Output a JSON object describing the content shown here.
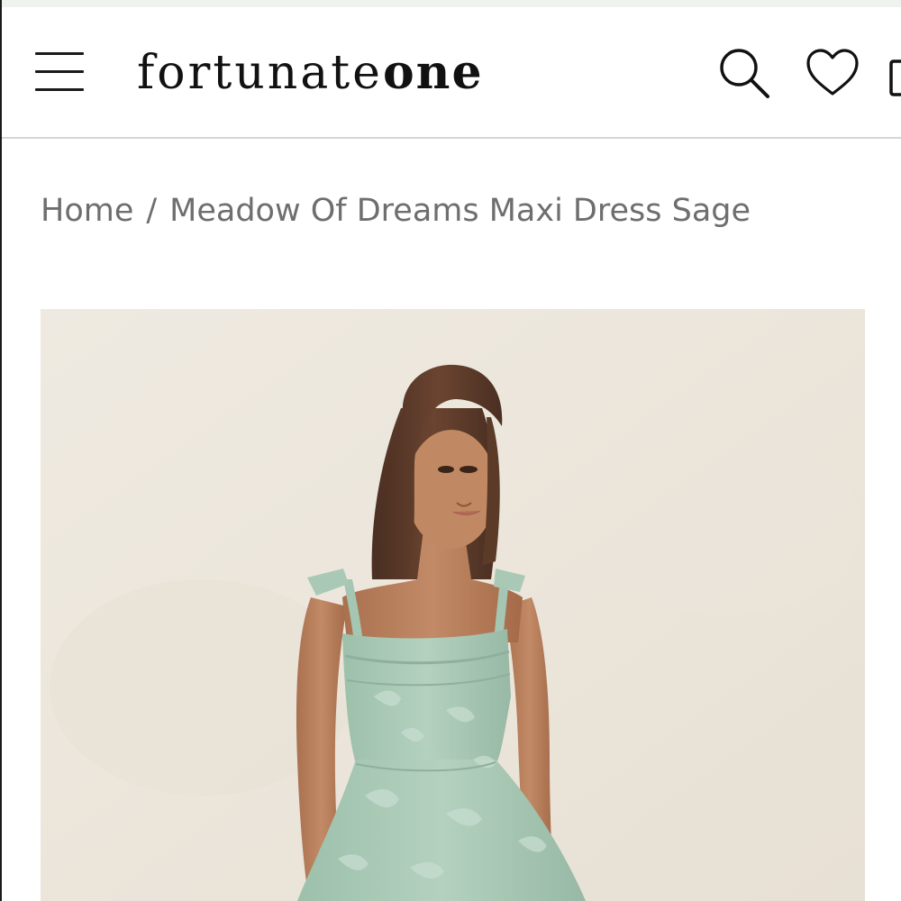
{
  "brand": {
    "logo_light": "fortunate",
    "logo_bold": "one"
  },
  "header": {
    "menu_icon": "hamburger-menu-icon",
    "search_icon": "search-icon",
    "wishlist_icon": "heart-icon",
    "cart_icon": "bag-icon"
  },
  "breadcrumb": {
    "home": "Home",
    "separator": "/",
    "current": "Meadow Of Dreams Maxi Dress Sage"
  },
  "product_image": {
    "alt": "Meadow Of Dreams Maxi Dress Sage"
  },
  "colors": {
    "text_dark": "#111111",
    "breadcrumb_text": "#6e6e6e",
    "divider": "#d6d6d6",
    "top_strip": "#eef3ee",
    "image_background": "#ece6dc",
    "dress_sage": "#a9c9b6"
  }
}
